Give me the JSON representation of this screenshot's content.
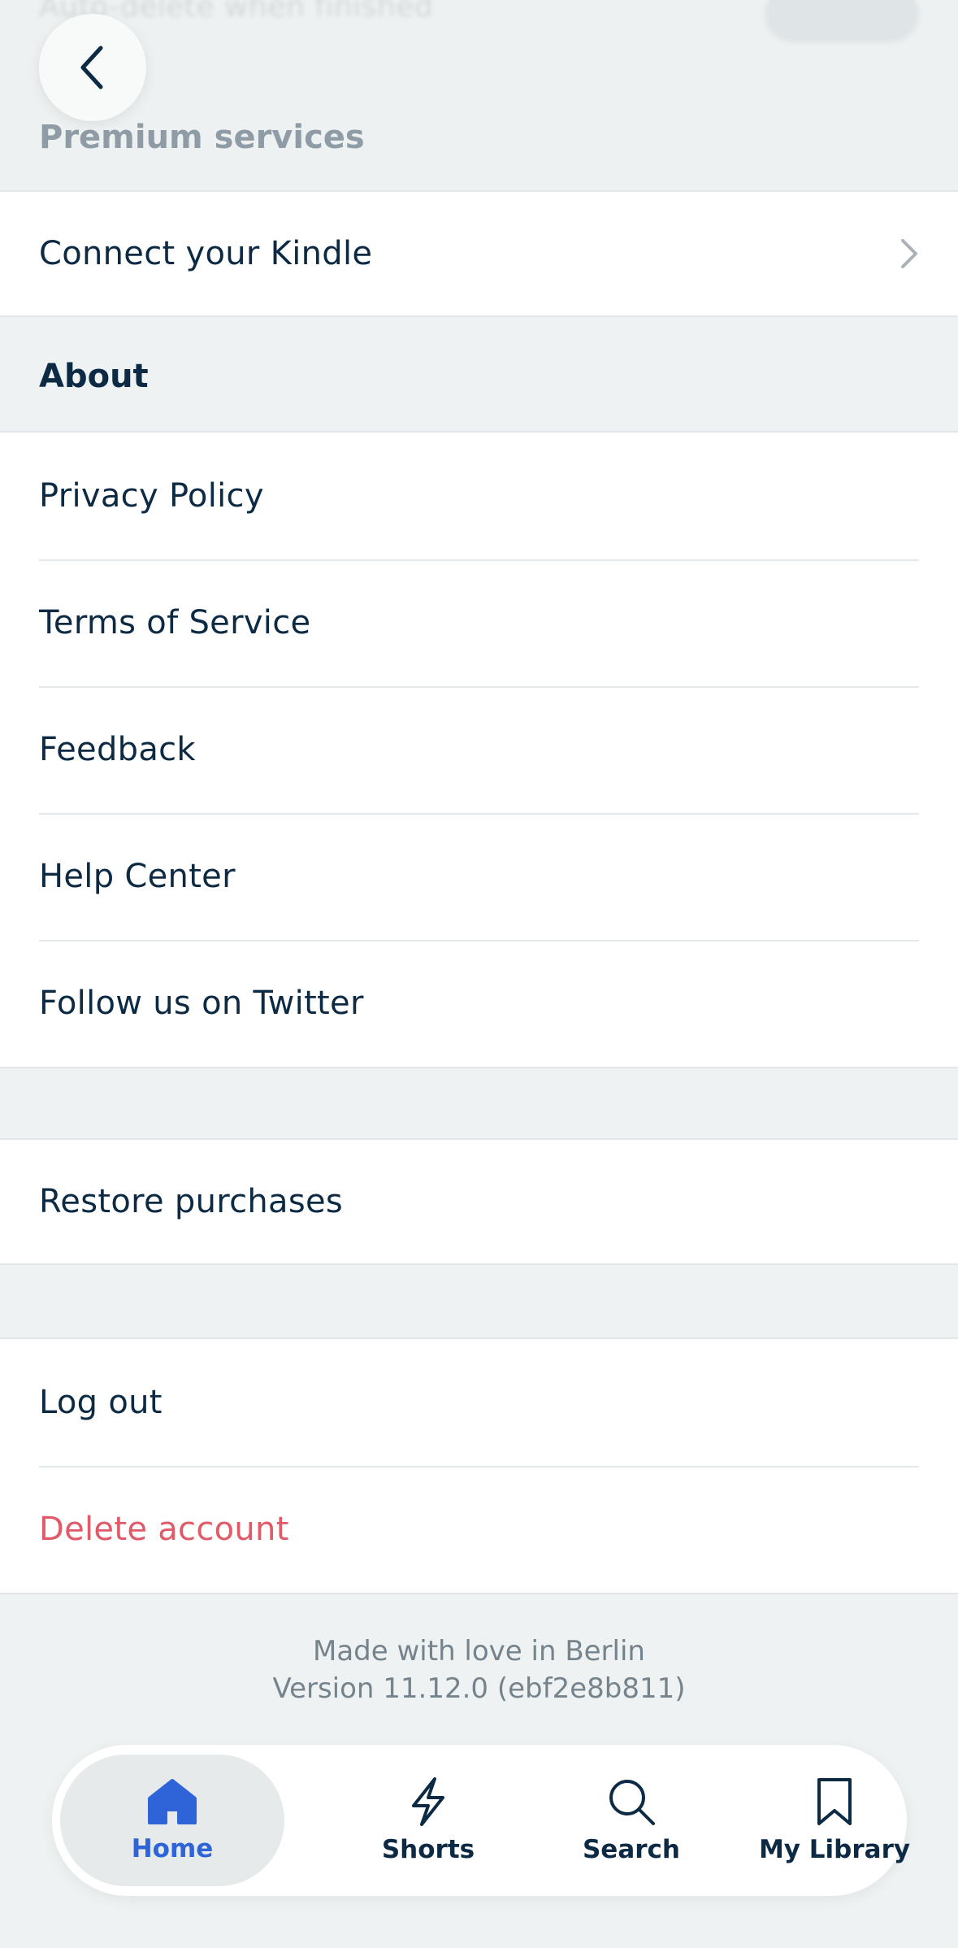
{
  "header": {
    "blurred_row": "Auto-delete when finished",
    "section_premium": "Premium services"
  },
  "premium": {
    "items": [
      {
        "label": "Connect your Kindle"
      }
    ]
  },
  "about": {
    "title": "About",
    "items": [
      {
        "label": "Privacy Policy"
      },
      {
        "label": "Terms of Service"
      },
      {
        "label": "Feedback"
      },
      {
        "label": "Help Center"
      },
      {
        "label": "Follow us on Twitter"
      }
    ]
  },
  "purchases": {
    "restore_label": "Restore purchases"
  },
  "account": {
    "logout_label": "Log out",
    "delete_label": "Delete account"
  },
  "footer": {
    "tagline": "Made with love in Berlin",
    "version": "Version 11.12.0 (ebf2e8b811)"
  },
  "tabbar": {
    "tabs": [
      {
        "label": "Home",
        "icon": "home-icon",
        "active": true
      },
      {
        "label": "Shorts",
        "icon": "lightning-icon",
        "active": false
      },
      {
        "label": "Search",
        "icon": "search-icon",
        "active": false
      },
      {
        "label": "My Library",
        "icon": "bookmark-icon",
        "active": false
      }
    ]
  },
  "colors": {
    "text": "#0d2a44",
    "danger": "#e05a68",
    "accent": "#2f63d8",
    "background": "#eff2f2"
  }
}
